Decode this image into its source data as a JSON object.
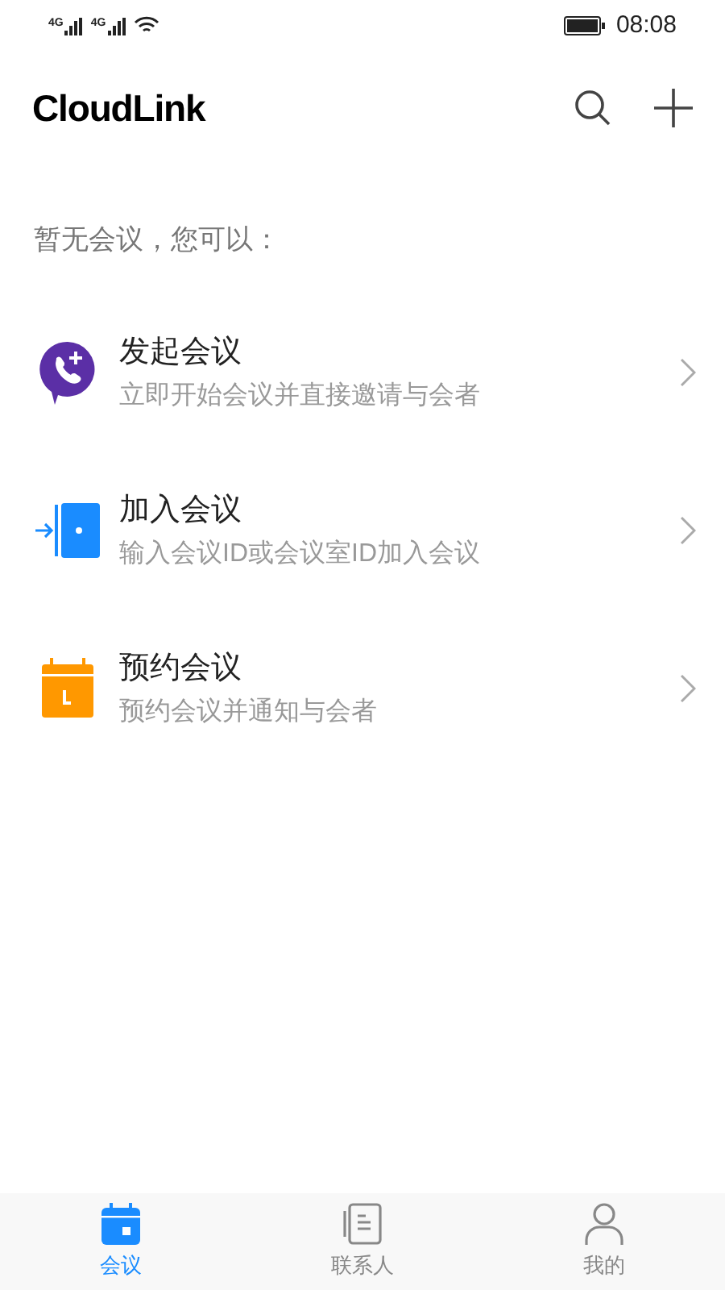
{
  "status_bar": {
    "sim_labels": [
      "4G",
      "4G"
    ],
    "time": "08:08"
  },
  "header": {
    "title": "CloudLink"
  },
  "empty_hint": "暂无会议，您可以：",
  "actions": [
    {
      "kind": "start",
      "title": "发起会议",
      "subtitle": "立即开始会议并直接邀请与会者"
    },
    {
      "kind": "join",
      "title": "加入会议",
      "subtitle": "输入会议ID或会议室ID加入会议"
    },
    {
      "kind": "schedule",
      "title": "预约会议",
      "subtitle": "预约会议并通知与会者"
    }
  ],
  "tab_bar": [
    {
      "kind": "meetings",
      "label": "会议",
      "selected": true
    },
    {
      "kind": "contacts",
      "label": "联系人",
      "selected": false
    },
    {
      "kind": "me",
      "label": "我的",
      "selected": false
    }
  ]
}
